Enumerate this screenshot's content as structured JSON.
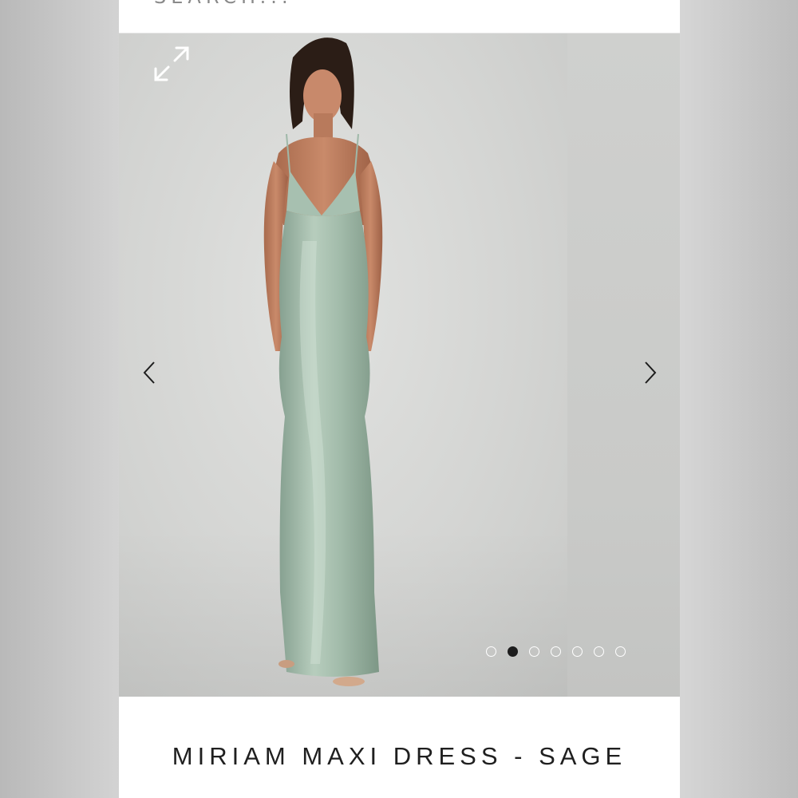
{
  "search": {
    "placeholder": "SEARCH..."
  },
  "gallery": {
    "image_alt": "Model wearing sage satin maxi dress",
    "total_slides": 7,
    "active_slide_index": 1,
    "icons": {
      "expand": "expand-icon",
      "prev": "chevron-left-icon",
      "next": "chevron-right-icon"
    }
  },
  "product": {
    "title": "MIRIAM MAXI DRESS - SAGE"
  },
  "colors": {
    "dress": "#9fb8a8",
    "background": "#d4d5d3",
    "text": "#1f1f1f",
    "dot_active": "#1d1d1d"
  }
}
